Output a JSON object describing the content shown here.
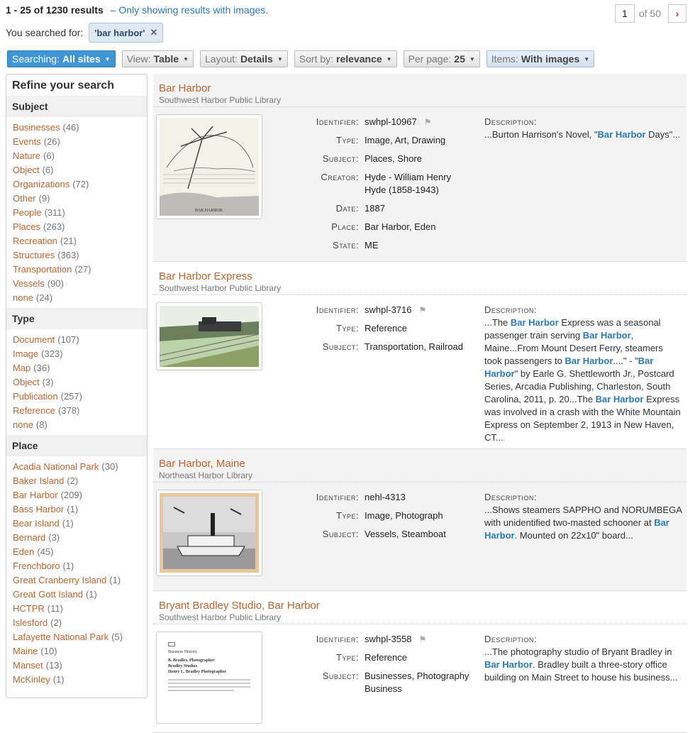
{
  "header": {
    "count": "1 - 25 of 1230 results",
    "images_link": "– Only showing results with images.",
    "page_current": "1",
    "page_total": "of 50",
    "next_glyph": "›",
    "searched_label": "You searched for:",
    "search_term": "'bar harbor'",
    "remove_glyph": "✕"
  },
  "filters": [
    {
      "label": "Searching:",
      "value": "All sites"
    },
    {
      "label": "View:",
      "value": "Table"
    },
    {
      "label": "Layout:",
      "value": "Details"
    },
    {
      "label": "Sort by:",
      "value": "relevance"
    },
    {
      "label": "Per page:",
      "value": "25"
    },
    {
      "label": "Items:",
      "value": "With images"
    }
  ],
  "sidebar": {
    "title": "Refine your search",
    "sections": [
      {
        "title": "Subject",
        "items": [
          {
            "name": "Businesses",
            "count": "(46)"
          },
          {
            "name": "Events",
            "count": "(26)"
          },
          {
            "name": "Nature",
            "count": "(6)"
          },
          {
            "name": "Object",
            "count": "(6)"
          },
          {
            "name": "Organizations",
            "count": "(72)"
          },
          {
            "name": "Other",
            "count": "(9)"
          },
          {
            "name": "People",
            "count": "(311)"
          },
          {
            "name": "Places",
            "count": "(263)"
          },
          {
            "name": "Recreation",
            "count": "(21)"
          },
          {
            "name": "Structures",
            "count": "(363)"
          },
          {
            "name": "Transportation",
            "count": "(27)"
          },
          {
            "name": "Vessels",
            "count": "(90)"
          },
          {
            "name": "none",
            "count": "(24)"
          }
        ]
      },
      {
        "title": "Type",
        "items": [
          {
            "name": "Document",
            "count": "(107)"
          },
          {
            "name": "Image",
            "count": "(323)"
          },
          {
            "name": "Map",
            "count": "(36)"
          },
          {
            "name": "Object",
            "count": "(3)"
          },
          {
            "name": "Publication",
            "count": "(257)"
          },
          {
            "name": "Reference",
            "count": "(378)"
          },
          {
            "name": "none",
            "count": "(8)"
          }
        ]
      },
      {
        "title": "Place",
        "items": [
          {
            "name": "Acadia National Park",
            "count": "(30)"
          },
          {
            "name": "Baker Island",
            "count": "(2)"
          },
          {
            "name": "Bar Harbor",
            "count": "(209)"
          },
          {
            "name": "Bass Harbor",
            "count": "(1)"
          },
          {
            "name": "Bear Island",
            "count": "(1)"
          },
          {
            "name": "Bernard",
            "count": "(3)"
          },
          {
            "name": "Eden",
            "count": "(45)"
          },
          {
            "name": "Frenchboro",
            "count": "(1)"
          },
          {
            "name": "Great Cranberry Island",
            "count": "(1)"
          },
          {
            "name": "Great Gott Island",
            "count": "(1)"
          },
          {
            "name": "HCTPR",
            "count": "(11)"
          },
          {
            "name": "Islesford",
            "count": "(2)"
          },
          {
            "name": "Lafayette National Park",
            "count": "(5)"
          },
          {
            "name": "Maine",
            "count": "(10)"
          },
          {
            "name": "Manset",
            "count": "(13)"
          },
          {
            "name": "McKinley",
            "count": "(1)"
          }
        ]
      }
    ]
  },
  "results": [
    {
      "title": "Bar Harbor",
      "library": "Southwest Harbor Public Library",
      "meta": [
        {
          "k": "Identifier:",
          "v": "swhpl-10967"
        },
        {
          "k": "Type:",
          "v": "Image, Art, Drawing"
        },
        {
          "k": "Subject:",
          "v": "Places, Shore"
        },
        {
          "k": "Creator:",
          "v": "Hyde - William Henry Hyde (1858-1943)"
        },
        {
          "k": "Date:",
          "v": "1887"
        },
        {
          "k": "Place:",
          "v": "Bar Harbor, Eden"
        },
        {
          "k": "State:",
          "v": "ME"
        }
      ],
      "desc_label": "Description:",
      "desc": [
        {
          "t": "...Burton Harrison's Novel, \""
        },
        {
          "t": "Bar Harbor",
          "hl": true
        },
        {
          "t": " Days\"..."
        }
      ],
      "thumb_caption": "BAR HARBOR."
    },
    {
      "title": "Bar Harbor Express",
      "library": "Southwest Harbor Public Library",
      "meta": [
        {
          "k": "Identifier:",
          "v": "swhpl-3716"
        },
        {
          "k": "Type:",
          "v": "Reference"
        },
        {
          "k": "Subject:",
          "v": "Transportation, Railroad"
        }
      ],
      "desc_label": "Description:",
      "desc": [
        {
          "t": "...The "
        },
        {
          "t": "Bar Harbor",
          "hl": true
        },
        {
          "t": " Express was a seasonal passenger train serving "
        },
        {
          "t": "Bar Harbor",
          "hl": true
        },
        {
          "t": ", Maine...From Mount Desert Ferry, steamers took passengers to "
        },
        {
          "t": "Bar Harbor",
          "hl": true
        },
        {
          "t": "....\" - \""
        },
        {
          "t": "Bar Harbor",
          "hl": true
        },
        {
          "t": "\" by Earle G. Shettleworth Jr., Postcard Series, Arcadia Publishing, Charleston, South Carolina, 2011, p. 20...The "
        },
        {
          "t": "Bar Harbor",
          "hl": true
        },
        {
          "t": " Express was involved in a crash with the White Mountain Express on September 2, 1913 in New Haven, CT..."
        }
      ]
    },
    {
      "title": "Bar Harbor, Maine",
      "library": "Northeast Harbor Library",
      "meta": [
        {
          "k": "Identifier:",
          "v": "nehl-4313"
        },
        {
          "k": "Type:",
          "v": "Image, Photograph"
        },
        {
          "k": "Subject:",
          "v": "Vessels, Steamboat"
        }
      ],
      "desc_label": "Description:",
      "desc": [
        {
          "t": "...Shows steamers SAPPHO and NORUMBEGA with unidentified two-masted schooner at "
        },
        {
          "t": "Bar Harbor",
          "hl": true
        },
        {
          "t": ". Mounted on 22x10\" board..."
        }
      ]
    },
    {
      "title": "Bryant Bradley Studio, Bar Harbor",
      "library": "Southwest Harbor Public Library",
      "meta": [
        {
          "k": "Identifier:",
          "v": "swhpl-3558"
        },
        {
          "k": "Type:",
          "v": "Reference"
        },
        {
          "k": "Subject:",
          "v": "Businesses, Photography Business"
        }
      ],
      "desc_label": "Description:",
      "desc": [
        {
          "t": "...The photography studio of Bryant Bradley in "
        },
        {
          "t": "Bar Harbor",
          "hl": true
        },
        {
          "t": ". Bradley built a three-story office building on Main Street to house his business..."
        }
      ],
      "doc_lines": [
        "Business History",
        "B. Bradley, Photographer",
        "Bradley Studios",
        "Henry L. Bradley Photographer"
      ]
    }
  ]
}
